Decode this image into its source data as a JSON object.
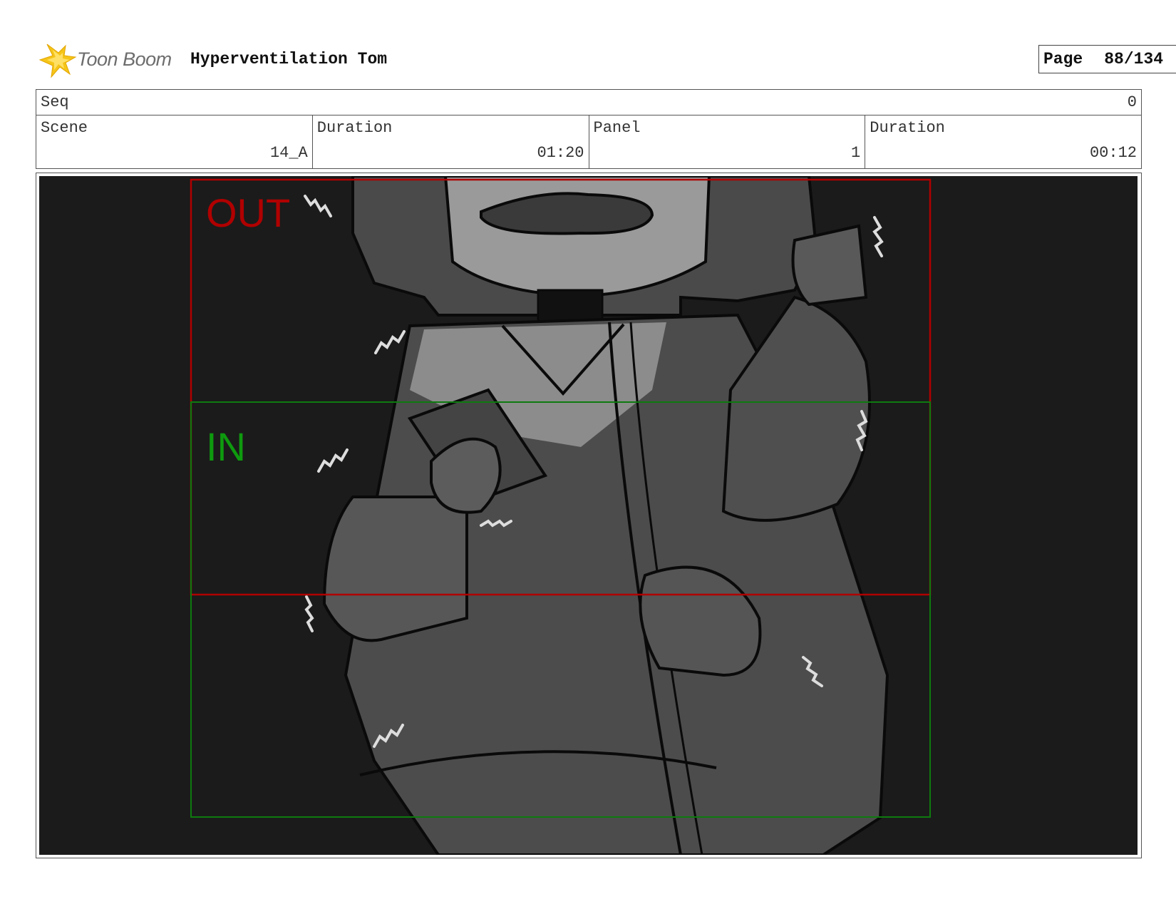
{
  "header": {
    "logo_text": "Toon Boom",
    "project_title": "Hyperventilation Tom",
    "page_label": "Page",
    "page_number": "88/134"
  },
  "seq": {
    "label": "Seq",
    "value": "0"
  },
  "details": {
    "scene_label": "Scene",
    "scene_value": "14_A",
    "scene_duration_label": "Duration",
    "scene_duration_value": "01:20",
    "panel_label": "Panel",
    "panel_value": "1",
    "panel_duration_label": "Duration",
    "panel_duration_value": "00:12"
  },
  "panel": {
    "out_label": "OUT",
    "in_label": "IN",
    "colors": {
      "out_frame": "#b00000",
      "in_frame": "#0e7a0e",
      "background": "#1b1b1b"
    }
  }
}
